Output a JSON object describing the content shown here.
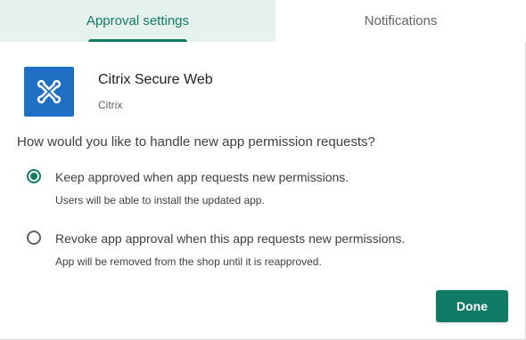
{
  "tabs": [
    {
      "label": "Approval settings",
      "active": true
    },
    {
      "label": "Notifications",
      "active": false
    }
  ],
  "app": {
    "name": "Citrix Secure Web",
    "vendor": "Citrix",
    "icon": "citrix-logo-icon",
    "icon_color": "#1f6fc5"
  },
  "question": "How would you like to handle new app permission requests?",
  "options": [
    {
      "label": "Keep approved when app requests new permissions.",
      "description": "Users will be able to install the updated app.",
      "selected": true
    },
    {
      "label": "Revoke app approval when this app requests new permissions.",
      "description": "App will be removed from the shop until it is reapproved.",
      "selected": false
    }
  ],
  "done_label": "Done",
  "colors": {
    "accent": "#137a63",
    "active_tab_bg": "#e6f2ee",
    "button_bg": "#0f7b65"
  }
}
